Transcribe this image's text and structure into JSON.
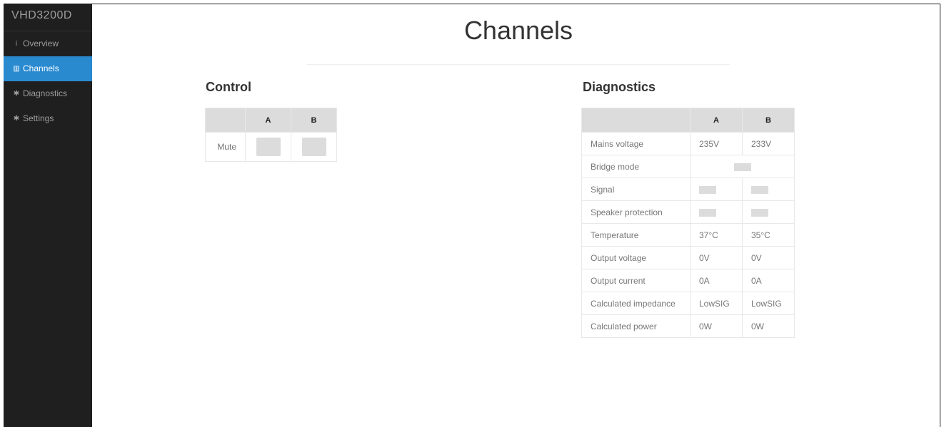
{
  "app": {
    "title": "VHD3200D"
  },
  "sidebar": {
    "items": [
      {
        "label": "Overview",
        "icon": "info-icon",
        "glyph": "i",
        "active": false
      },
      {
        "label": "Channels",
        "icon": "bar-chart-icon",
        "glyph": "▥",
        "active": true
      },
      {
        "label": "Diagnostics",
        "icon": "gear-icon",
        "glyph": "✱",
        "active": false
      },
      {
        "label": "Settings",
        "icon": "gear-icon",
        "glyph": "✱",
        "active": false
      }
    ]
  },
  "page": {
    "title": "Channels"
  },
  "control": {
    "heading": "Control",
    "columns": [
      "",
      "A",
      "B"
    ],
    "mute_label": "Mute"
  },
  "diagnostics": {
    "heading": "Diagnostics",
    "columns": [
      "",
      "A",
      "B"
    ],
    "rows": {
      "mains": {
        "label": "Mains voltage",
        "a": "235V",
        "b": "233V"
      },
      "bridge": {
        "label": "Bridge mode"
      },
      "signal": {
        "label": "Signal"
      },
      "speaker": {
        "label": "Speaker protection"
      },
      "temp": {
        "label": "Temperature",
        "a": "37°C",
        "b": "35°C"
      },
      "outv": {
        "label": "Output voltage",
        "a": "0V",
        "b": "0V"
      },
      "outc": {
        "label": "Output current",
        "a": "0A",
        "b": "0A"
      },
      "imp": {
        "label": "Calculated impedance",
        "a": "LowSIG",
        "b": "LowSIG"
      },
      "power": {
        "label": "Calculated power",
        "a": "0W",
        "b": "0W"
      }
    }
  },
  "colors": {
    "accent": "#2a8ad0",
    "sidebar_bg": "#1f1f1f",
    "indicator": "#dcdcdc"
  }
}
